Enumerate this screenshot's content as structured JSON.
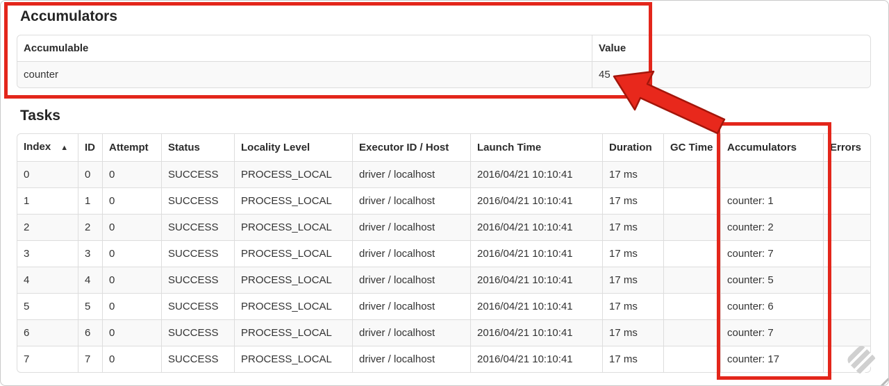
{
  "annotations": {
    "color": "#e3261b",
    "arrow_points_at": "45"
  },
  "accumulators_section": {
    "title": "Accumulators",
    "table": {
      "headers": [
        "Accumulable",
        "Value"
      ],
      "row": {
        "name": "counter",
        "value": "45"
      }
    }
  },
  "tasks_section": {
    "title": "Tasks",
    "table": {
      "sort_icon": "▲",
      "column_keys": [
        "index",
        "id",
        "attempt",
        "status",
        "locality",
        "executor",
        "launch_time",
        "duration",
        "gc_time",
        "accumulators",
        "errors"
      ],
      "headers": [
        {
          "key": "index",
          "label": "Index",
          "sort": "▲"
        },
        {
          "key": "id",
          "label": "ID"
        },
        {
          "key": "attempt",
          "label": "Attempt"
        },
        {
          "key": "status",
          "label": "Status"
        },
        {
          "key": "locality",
          "label": "Locality Level"
        },
        {
          "key": "executor",
          "label": "Executor ID / Host"
        },
        {
          "key": "launch_time",
          "label": "Launch Time"
        },
        {
          "key": "duration",
          "label": "Duration"
        },
        {
          "key": "gc_time",
          "label": "GC Time"
        },
        {
          "key": "accumulators",
          "label": "Accumulators"
        },
        {
          "key": "errors",
          "label": "Errors"
        }
      ],
      "rows": [
        {
          "index": "0",
          "id": "0",
          "attempt": "0",
          "status": "SUCCESS",
          "locality": "PROCESS_LOCAL",
          "executor": "driver / localhost",
          "launch_time": "2016/04/21 10:10:41",
          "duration": "17 ms",
          "gc_time": "",
          "accumulators": "",
          "errors": ""
        },
        {
          "index": "1",
          "id": "1",
          "attempt": "0",
          "status": "SUCCESS",
          "locality": "PROCESS_LOCAL",
          "executor": "driver / localhost",
          "launch_time": "2016/04/21 10:10:41",
          "duration": "17 ms",
          "gc_time": "",
          "accumulators": "counter: 1",
          "errors": ""
        },
        {
          "index": "2",
          "id": "2",
          "attempt": "0",
          "status": "SUCCESS",
          "locality": "PROCESS_LOCAL",
          "executor": "driver / localhost",
          "launch_time": "2016/04/21 10:10:41",
          "duration": "17 ms",
          "gc_time": "",
          "accumulators": "counter: 2",
          "errors": ""
        },
        {
          "index": "3",
          "id": "3",
          "attempt": "0",
          "status": "SUCCESS",
          "locality": "PROCESS_LOCAL",
          "executor": "driver / localhost",
          "launch_time": "2016/04/21 10:10:41",
          "duration": "17 ms",
          "gc_time": "",
          "accumulators": "counter: 7",
          "errors": ""
        },
        {
          "index": "4",
          "id": "4",
          "attempt": "0",
          "status": "SUCCESS",
          "locality": "PROCESS_LOCAL",
          "executor": "driver / localhost",
          "launch_time": "2016/04/21 10:10:41",
          "duration": "17 ms",
          "gc_time": "",
          "accumulators": "counter: 5",
          "errors": ""
        },
        {
          "index": "5",
          "id": "5",
          "attempt": "0",
          "status": "SUCCESS",
          "locality": "PROCESS_LOCAL",
          "executor": "driver / localhost",
          "launch_time": "2016/04/21 10:10:41",
          "duration": "17 ms",
          "gc_time": "",
          "accumulators": "counter: 6",
          "errors": ""
        },
        {
          "index": "6",
          "id": "6",
          "attempt": "0",
          "status": "SUCCESS",
          "locality": "PROCESS_LOCAL",
          "executor": "driver / localhost",
          "launch_time": "2016/04/21 10:10:41",
          "duration": "17 ms",
          "gc_time": "",
          "accumulators": "counter: 7",
          "errors": ""
        },
        {
          "index": "7",
          "id": "7",
          "attempt": "0",
          "status": "SUCCESS",
          "locality": "PROCESS_LOCAL",
          "executor": "driver / localhost",
          "launch_time": "2016/04/21 10:10:41",
          "duration": "17 ms",
          "gc_time": "",
          "accumulators": "counter: 17",
          "errors": ""
        }
      ]
    }
  }
}
